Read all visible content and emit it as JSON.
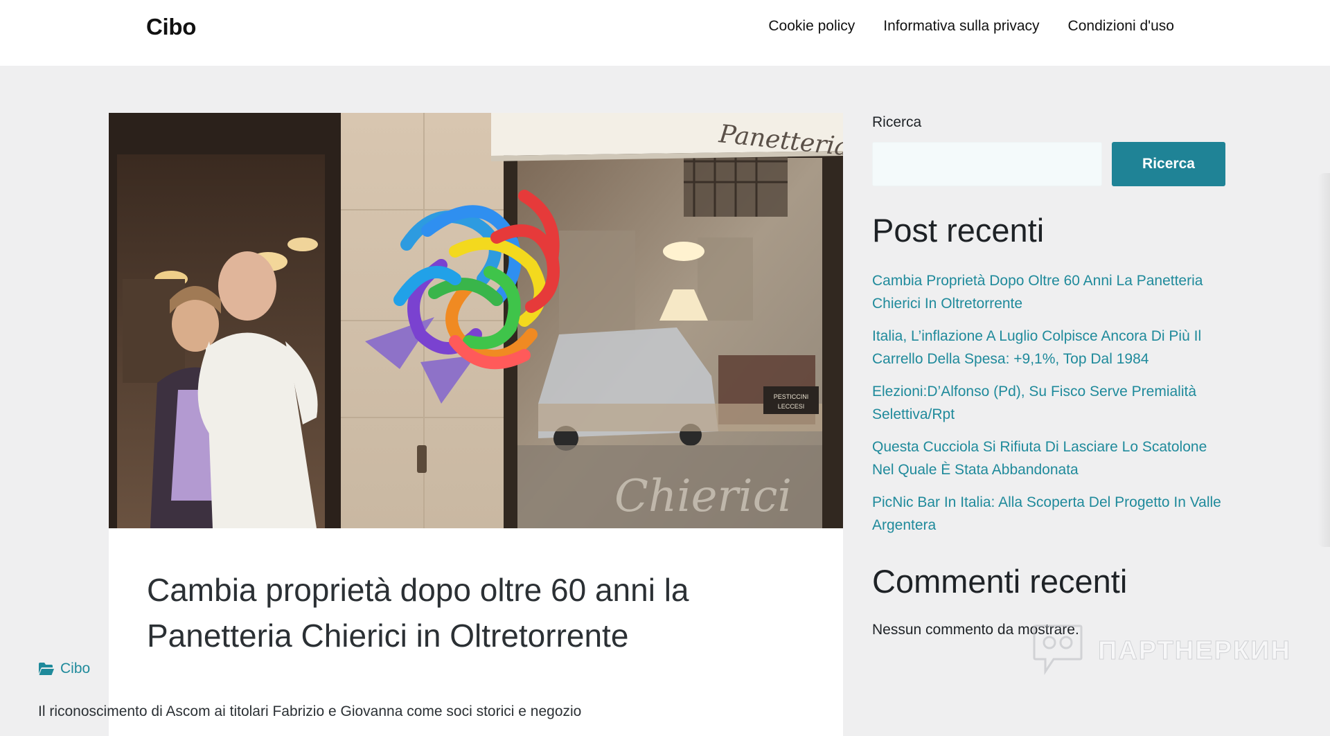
{
  "site": {
    "title": "Cibo",
    "nav": [
      {
        "label": "Cookie policy"
      },
      {
        "label": "Informativa sulla privacy"
      },
      {
        "label": "Condizioni d'uso"
      }
    ]
  },
  "article": {
    "title": "Cambia proprietà dopo oltre 60 anni la Panetteria Chierici in Oltretorrente",
    "category": "Cibo",
    "category_icon": "folder-open-icon",
    "excerpt": "Il riconoscimento di Ascom ai titolari Fabrizio e Giovanna come soci storici e negozio",
    "image": {
      "shop_sign": "Panetteria",
      "window_text": "Chierici",
      "box_label_top": "PESTICCINI",
      "box_label_bottom": "LECCESI"
    }
  },
  "sidebar": {
    "search": {
      "label": "Ricerca",
      "placeholder": "",
      "button_label": "Ricerca"
    },
    "recent_posts": {
      "heading": "Post recenti",
      "items": [
        {
          "label": "Cambia Proprietà Dopo Oltre 60 Anni La Panetteria Chierici In Oltretorrente"
        },
        {
          "label": "Italia, L’inflazione A Luglio Colpisce Ancora Di Più Il Carrello Della Spesa: +9,1%, Top Dal 1984"
        },
        {
          "label": "Elezioni:D’Alfonso (Pd), Su Fisco Serve Premialità Selettiva/Rpt"
        },
        {
          "label": "Questa Cucciola Si Rifiuta Di Lasciare Lo Scatolone Nel Quale È Stata Abbandonata"
        },
        {
          "label": "PicNic Bar In Italia: Alla Scoperta Del Progetto In Valle Argentera"
        }
      ]
    },
    "recent_comments": {
      "heading": "Commenti recenti",
      "empty_text": "Nessun commento da mostrare."
    }
  },
  "watermark": {
    "text": "ПАРТНЕРКИН",
    "icon": "chat-bubble-icon"
  },
  "colors": {
    "accent": "#1f8396",
    "link": "#1f8a9b",
    "background": "#efeff0"
  }
}
